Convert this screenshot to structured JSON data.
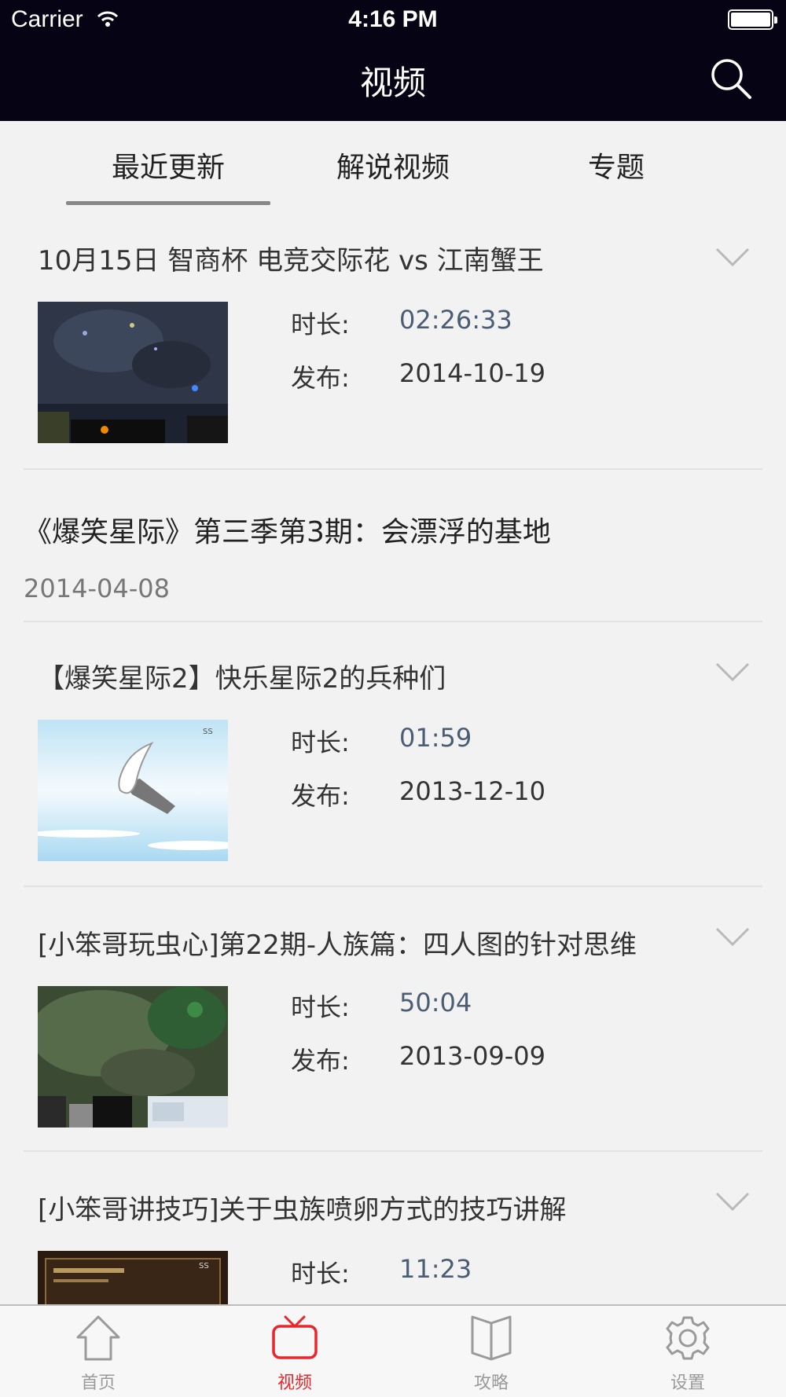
{
  "status_bar": {
    "carrier": "Carrier",
    "time": "4:16 PM"
  },
  "nav": {
    "title": "视频"
  },
  "tabs": [
    {
      "label": "最近更新",
      "selected": true
    },
    {
      "label": "解说视频",
      "selected": false
    },
    {
      "label": "专题",
      "selected": false
    }
  ],
  "meta_labels": {
    "duration": "时长:",
    "published": "发布:"
  },
  "videos": [
    {
      "title": "10月15日 智商杯 电竞交际花 vs 江南蟹王",
      "duration": "02:26:33",
      "date": "2014-10-19",
      "thumb": "game-dark"
    },
    {
      "title": "《爆笑星际》第三季第3期：会漂浮的基地",
      "date": "2014-04-08"
    },
    {
      "title": "【爆笑星际2】快乐星际2的兵种们",
      "duration": "01:59",
      "date": "2013-12-10",
      "thumb": "cartoon-hammer"
    },
    {
      "title": "[小笨哥玩虫心]第22期-人族篇：四人图的针对思维",
      "duration": "50:04",
      "date": "2013-09-09",
      "thumb": "game-green"
    },
    {
      "title": "[小笨哥讲技巧]关于虫族喷卵方式的技巧讲解",
      "duration": "11:23",
      "thumb": "game-menu"
    }
  ],
  "tabbar": [
    {
      "label": "首页",
      "icon": "home-icon",
      "active": false
    },
    {
      "label": "视频",
      "icon": "tv-icon",
      "active": true
    },
    {
      "label": "攻略",
      "icon": "book-icon",
      "active": false
    },
    {
      "label": "设置",
      "icon": "gear-icon",
      "active": false
    }
  ],
  "colors": {
    "nav_bg": "#060314",
    "accent": "#e8262b",
    "duration_text": "#4a5d75",
    "background": "#f2f2f2"
  }
}
